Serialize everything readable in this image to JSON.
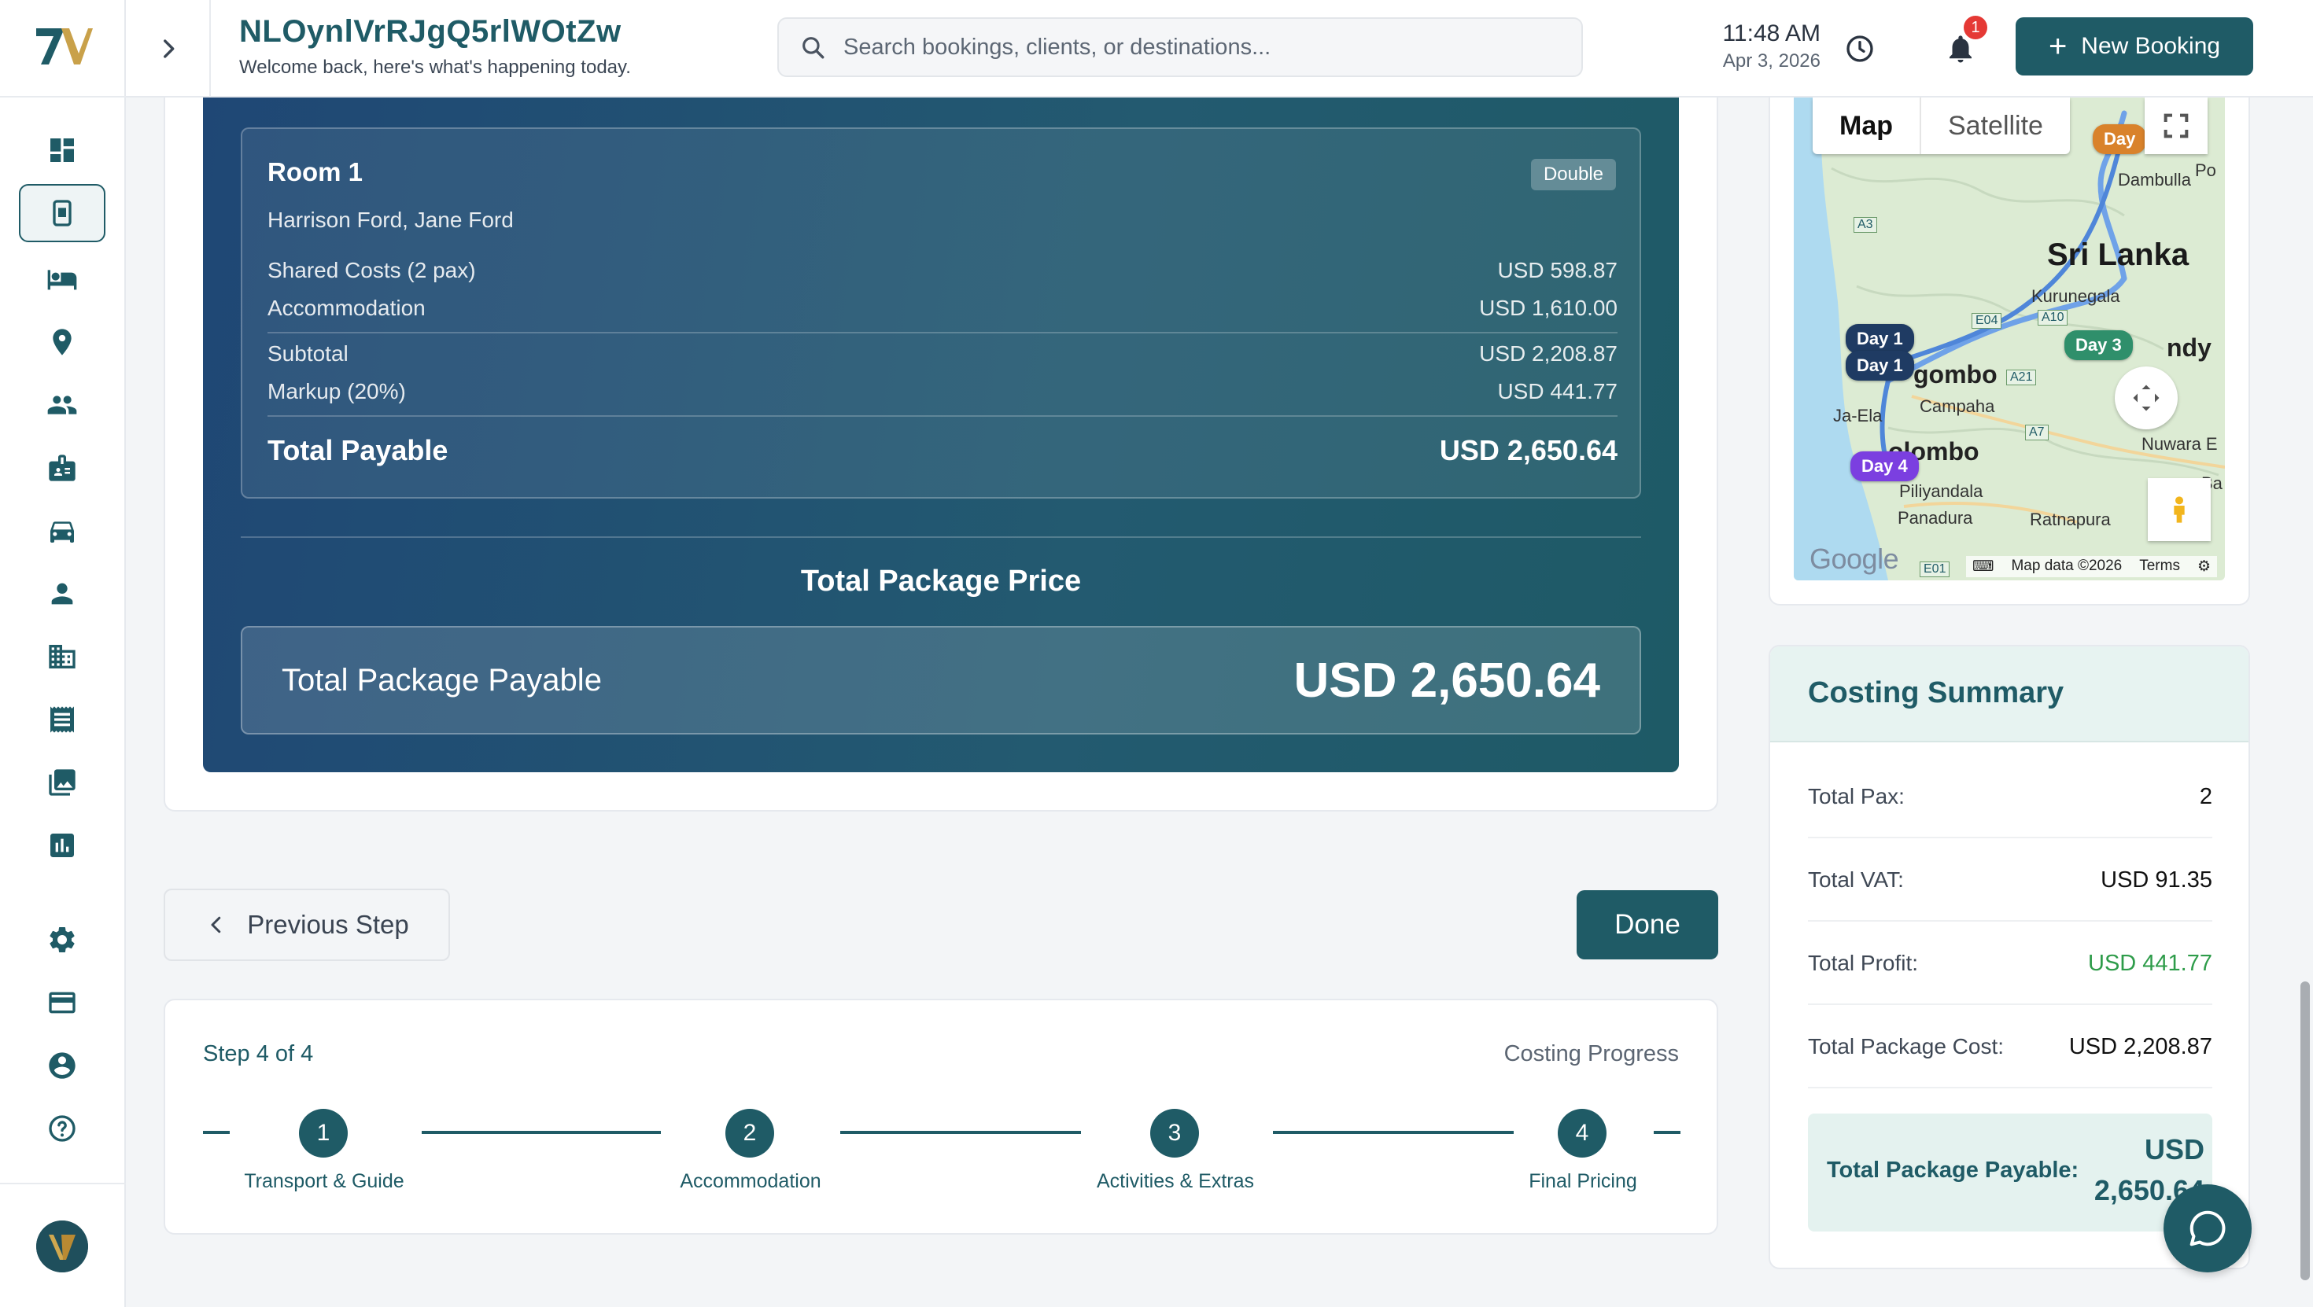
{
  "header": {
    "title": "NLOynlVrRJgQ5rlWOtZw",
    "subtitle": "Welcome back, here's what's happening today.",
    "search_placeholder": "Search bookings, clients, or destinations...",
    "time": "11:48 AM",
    "date": "Apr 3, 2026",
    "notification_count": "1",
    "new_booking_label": "New Booking"
  },
  "sidebar": {
    "items": [
      {
        "icon": "dashboard-icon"
      },
      {
        "icon": "booking-icon",
        "active": true
      },
      {
        "icon": "bed-icon"
      },
      {
        "icon": "location-pin-icon"
      },
      {
        "icon": "people-icon"
      },
      {
        "icon": "badge-icon"
      },
      {
        "icon": "car-icon"
      },
      {
        "icon": "person-icon"
      },
      {
        "icon": "building-icon"
      },
      {
        "icon": "receipt-icon"
      },
      {
        "icon": "gallery-icon"
      },
      {
        "icon": "chart-icon"
      },
      {
        "icon": "settings-icon"
      },
      {
        "icon": "credit-card-icon"
      },
      {
        "icon": "account-circle-icon"
      },
      {
        "icon": "help-icon"
      }
    ]
  },
  "room": {
    "title": "Room 1",
    "type": "Double",
    "guests": "Harrison Ford, Jane Ford",
    "shared_costs_label": "Shared Costs (2 pax)",
    "shared_costs_value": "USD 598.87",
    "accommodation_label": "Accommodation",
    "accommodation_value": "USD 1,610.00",
    "subtotal_label": "Subtotal",
    "subtotal_value": "USD 2,208.87",
    "markup_label": "Markup (20%)",
    "markup_value": "USD 441.77",
    "total_label": "Total Payable",
    "total_value": "USD 2,650.64"
  },
  "package": {
    "heading": "Total Package Price",
    "label": "Total Package Payable",
    "value": "USD 2,650.64"
  },
  "navigation": {
    "previous_label": "Previous Step",
    "done_label": "Done"
  },
  "stepper": {
    "step_of": "Step 4 of 4",
    "progress_label": "Costing Progress",
    "steps": [
      {
        "number": "1",
        "label": "Transport & Guide"
      },
      {
        "number": "2",
        "label": "Accommodation"
      },
      {
        "number": "3",
        "label": "Activities & Extras"
      },
      {
        "number": "4",
        "label": "Final Pricing"
      }
    ]
  },
  "map": {
    "tab_map": "Map",
    "tab_satellite": "Satellite",
    "markers": [
      "Day",
      "Day 1",
      "Day 1",
      "Day 3",
      "Day 4"
    ],
    "labels": {
      "country": "Sri Lanka",
      "dambulla": "Dambulla",
      "kurunegala": "Kurunegala",
      "negombo": "gombo",
      "kandy": "ndy",
      "campaha": "Campaha",
      "jaela": "Ja-Ela",
      "colombo": "olombo",
      "nuwara": "Nuwara E",
      "piliyandala": "Piliyandala",
      "panadura": "Panadura",
      "ratnapura": "Ratnapura",
      "po": "Po",
      "ba": "Ba"
    },
    "road_shields": [
      "A3",
      "E04",
      "A10",
      "A21",
      "A7",
      "E01"
    ],
    "google": "Google",
    "attribution": "Map data ©2026",
    "terms": "Terms",
    "marker_colors": {
      "day_orange": "#d9822b",
      "day_navy": "#1f3b63",
      "day_green": "#2f8f6b",
      "day_purple": "#7b3fe0"
    }
  },
  "summary": {
    "title": "Costing Summary",
    "rows": [
      {
        "label": "Total Pax:",
        "value": "2"
      },
      {
        "label": "Total VAT:",
        "value": "USD 91.35"
      },
      {
        "label": "Total Profit:",
        "value": "USD 441.77"
      },
      {
        "label": "Total Package Cost:",
        "value": "USD 2,208.87"
      }
    ],
    "total_label": "Total Package Payable:",
    "total_value": "USD 2,650.64"
  },
  "colors": {
    "primary": "#1f5b66",
    "profit_green": "#2e9c4a",
    "alert_red": "#e53935"
  }
}
